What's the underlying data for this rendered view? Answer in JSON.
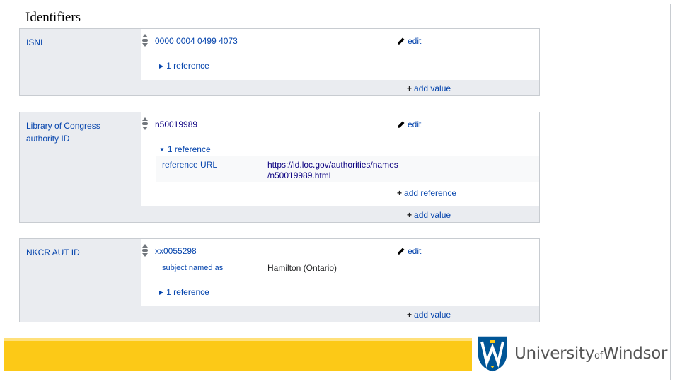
{
  "section": {
    "title": "Identifiers"
  },
  "statements": [
    {
      "property": "ISNI",
      "value": "0000 0004 0499 4073",
      "edit_label": "edit",
      "reference_toggle": "1 reference",
      "add_value_label": "add value"
    },
    {
      "property": "Library of Congress authority ID",
      "value": "n50019989",
      "edit_label": "edit",
      "reference_toggle": "1 reference",
      "reference": {
        "key": "reference URL",
        "value_line1": "https://id.loc.gov/authorities/names",
        "value_line2": "/n50019989.html"
      },
      "add_reference_label": "add reference",
      "add_value_label": "add value"
    },
    {
      "property": "NKCR AUT ID",
      "value": "xx0055298",
      "edit_label": "edit",
      "qualifier": {
        "key": "subject named as",
        "value": "Hamilton (Ontario)"
      },
      "reference_toggle": "1 reference",
      "add_value_label": "add value"
    }
  ],
  "branding": {
    "university": "University",
    "of": "of",
    "windsor": "Windsor",
    "colors": {
      "gold": "#fcc917",
      "blue": "#005596"
    }
  },
  "icons": {
    "edit": "pencil-icon",
    "add": "plus-icon",
    "rank": "normal-rank-icon",
    "expand": "triangle-icon"
  }
}
